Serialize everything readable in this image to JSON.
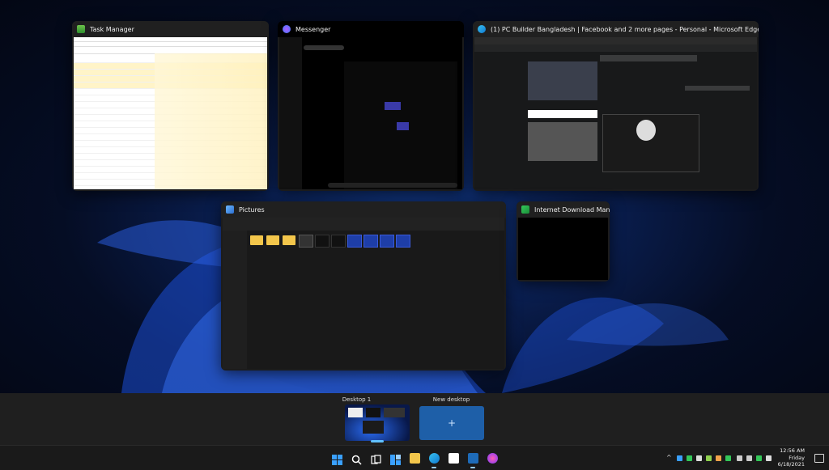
{
  "windows": {
    "task_manager": {
      "title": "Task Manager"
    },
    "messenger": {
      "title": "Messenger"
    },
    "edge": {
      "title": "(1) PC Builder Bangladesh | Facebook and 2 more pages - Personal - Microsoft Edge"
    },
    "pictures": {
      "title": "Pictures"
    },
    "idm": {
      "title": "Internet Download Man..."
    }
  },
  "desktops": {
    "desktop1_label": "Desktop 1",
    "new_desktop_label": "New desktop",
    "new_desktop_plus": "+"
  },
  "taskbar": {
    "clock_time": "12:56 AM",
    "clock_day": "Friday",
    "clock_date": "6/18/2021"
  },
  "colors": {
    "accent": "#0078d4",
    "folder": "#f3c64b"
  }
}
